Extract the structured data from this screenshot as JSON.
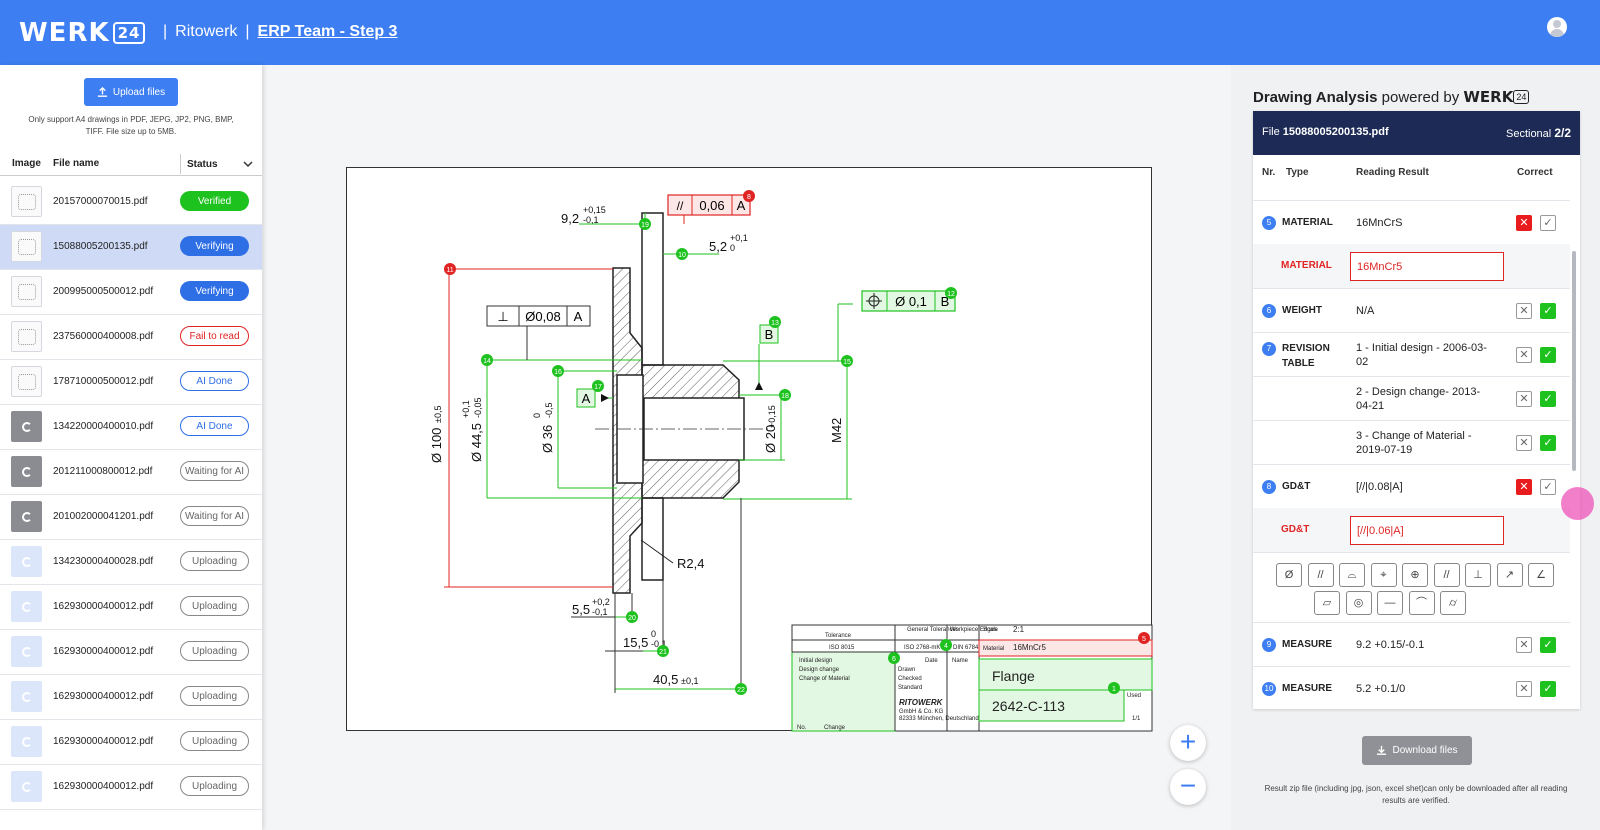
{
  "header": {
    "logo_text": "WERK",
    "logo_num": "24",
    "company": "Ritowerk",
    "separator": "|",
    "project_link": "ERP Team - Step 3"
  },
  "sidebar": {
    "upload_label": "Upload files",
    "upload_note": "Only support A4 drawings in PDF, JEPG, JP2, PNG, BMP, TIFF. File size up to 5MB.",
    "col_image": "Image",
    "col_filename": "File name",
    "col_status": "Status",
    "files": [
      {
        "name": "20157000070015.pdf",
        "status": "Verified",
        "kind": "verified",
        "thumb": "sketch"
      },
      {
        "name": "15088005200135.pdf",
        "status": "Verifying",
        "kind": "verifying",
        "thumb": "sketch",
        "active": true
      },
      {
        "name": "200995000500012.pdf",
        "status": "Verifying",
        "kind": "verifying",
        "thumb": "sketch"
      },
      {
        "name": "237560000400008.pdf",
        "status": "Fail to read",
        "kind": "fail",
        "thumb": "sketch"
      },
      {
        "name": "178710000500012.pdf",
        "status": "AI Done",
        "kind": "ai",
        "thumb": "sketch"
      },
      {
        "name": "134220000400010.pdf",
        "status": "AI Done",
        "kind": "ai",
        "thumb": "gray"
      },
      {
        "name": "201211000800012.pdf",
        "status": "Waiting for AI",
        "kind": "wait",
        "thumb": "gray"
      },
      {
        "name": "201002000041201.pdf",
        "status": "Waiting for AI",
        "kind": "wait",
        "thumb": "gray"
      },
      {
        "name": "134230000400028.pdf",
        "status": "Uploading",
        "kind": "up",
        "thumb": "blue"
      },
      {
        "name": "162930000400012.pdf",
        "status": "Uploading",
        "kind": "up",
        "thumb": "blue"
      },
      {
        "name": "162930000400012.pdf",
        "status": "Uploading",
        "kind": "up",
        "thumb": "blue"
      },
      {
        "name": "162930000400012.pdf",
        "status": "Uploading",
        "kind": "up",
        "thumb": "blue"
      },
      {
        "name": "162930000400012.pdf",
        "status": "Uploading",
        "kind": "up",
        "thumb": "blue"
      },
      {
        "name": "162930000400012.pdf",
        "status": "Uploading",
        "kind": "up",
        "thumb": "blue"
      }
    ]
  },
  "drawing": {
    "dims": {
      "d1": "9,2",
      "d1_tol_up": "+0,15",
      "d1_tol_dn": "-0,1",
      "d2": "5,2",
      "d2_tol_up": "+0,1",
      "d2_tol_dn": "0",
      "d3": "Ø 100",
      "d3_tol": "±0,5",
      "d4": "Ø 44,5",
      "d4_tol_up": "+0,1",
      "d4_tol_dn": "-0,05",
      "d5": "Ø 36",
      "d5_tol_up": "0",
      "d5_tol_dn": "-0,5",
      "d6": "Ø 20",
      "d6_tol": "+0,15",
      "d7": "M42",
      "d8": "R2,4",
      "d9": "5,5",
      "d9_tol_up": "+0,2",
      "d9_tol_dn": "-0,1",
      "d10": "15,5",
      "d10_tol_up": "0",
      "d10_tol_dn": "-0,1",
      "d11": "40,5",
      "d11_tol": "±0,1"
    },
    "fcf_parallel": {
      "sym": "//",
      "val": "0,06",
      "ref": "A"
    },
    "fcf_perp": {
      "sym": "⊥",
      "val": "Ø0,08",
      "ref": "A"
    },
    "fcf_position": {
      "val": "Ø 0,1",
      "ref": "B"
    },
    "datum_a": "A",
    "datum_b": "B",
    "markers": [
      "1",
      "4",
      "5",
      "6",
      "8",
      "10",
      "11",
      "12",
      "13",
      "14",
      "15",
      "16",
      "17",
      "18",
      "19",
      "20",
      "21",
      "22"
    ],
    "title_block": {
      "tolerance": "Tolerance",
      "general_tol": "General Tolerances",
      "workpiece_edges": "Workpiece Edges",
      "scale_label": "Scale",
      "scale": "2:1",
      "iso1": "ISO 8015",
      "iso2": "ISO 2768-mK",
      "din": "DIN 6784",
      "material_label": "Material",
      "material": "16MnCr5",
      "date": "Date",
      "name": "Name",
      "drawn": "Drawn",
      "checked": "Checked",
      "standard": "Standard",
      "title": "Flange",
      "part_no": "2642-C-113",
      "company": "RITOWERK",
      "address1": "GmbH & Co. KG",
      "address2": "82333 München, Deutschland",
      "rev1": "Initial design",
      "rev2": "Design change",
      "rev3": "Change of Material",
      "no": "No.",
      "change": "Change",
      "used": "Used",
      "sheet": "1/1"
    }
  },
  "panel": {
    "title_bold": "Drawing Analysis",
    "title_rest": "powered by",
    "brand": "WERK",
    "brand_num": "24",
    "file_label": "File",
    "file_name": "15088005200135.pdf",
    "sectional_label": "Sectional",
    "sectional_val": "2/2",
    "col_nr": "Nr.",
    "col_type": "Type",
    "col_result": "Reading Result",
    "col_correct": "Correct",
    "rows": [
      {
        "nr": "5",
        "type": "MATERIAL",
        "value": "16MnCrS",
        "x": "red",
        "c": "plain"
      },
      {
        "nr": "6",
        "type": "WEIGHT",
        "value": "N/A",
        "x": "plain",
        "c": "green"
      },
      {
        "nr": "7",
        "type": "REVISION TABLE",
        "value": "1 - Initial design - 2006-03-02",
        "x": "plain",
        "c": "green"
      },
      {
        "nr": "",
        "type": "",
        "value": "2 - Design change- 2013-04-21",
        "x": "plain",
        "c": "green"
      },
      {
        "nr": "",
        "type": "",
        "value": "3 - Change of Material - 2019-07-19",
        "x": "plain",
        "c": "green"
      },
      {
        "nr": "8",
        "type": "GD&T",
        "value": "[//|0.08|A]",
        "x": "red",
        "c": "plain"
      },
      {
        "nr": "9",
        "type": "MEASURE",
        "value": "9.2 +0.15/-0.1",
        "x": "plain",
        "c": "green"
      },
      {
        "nr": "10",
        "type": "MEASURE",
        "value": "5.2 +0.1/0",
        "x": "plain",
        "c": "green"
      }
    ],
    "correction_material": {
      "label": "MATERIAL",
      "value": "16MnCr5"
    },
    "correction_gdt": {
      "label": "GD&T",
      "value": "[//|0.06|A]"
    },
    "symbols_row1": [
      "Ø",
      "//",
      "⌓",
      "⌖",
      "⊕",
      "//",
      "⊥",
      "↗",
      "∠"
    ],
    "symbols_row2": [
      "▱",
      "◎",
      "—",
      "⌒",
      "⌭"
    ],
    "download_label": "Download files",
    "download_note": "Result zip file (including jpg, json, excel shet)can only be downloaded after all reading results are verified.",
    "x_glyph": "✕",
    "check_glyph": "✓"
  },
  "zoom": {
    "in": "+",
    "out": "−"
  },
  "colors": {
    "header": "#3d7ef2",
    "navy": "#1c2a55",
    "green": "#1ec21e",
    "red": "#e02424"
  }
}
